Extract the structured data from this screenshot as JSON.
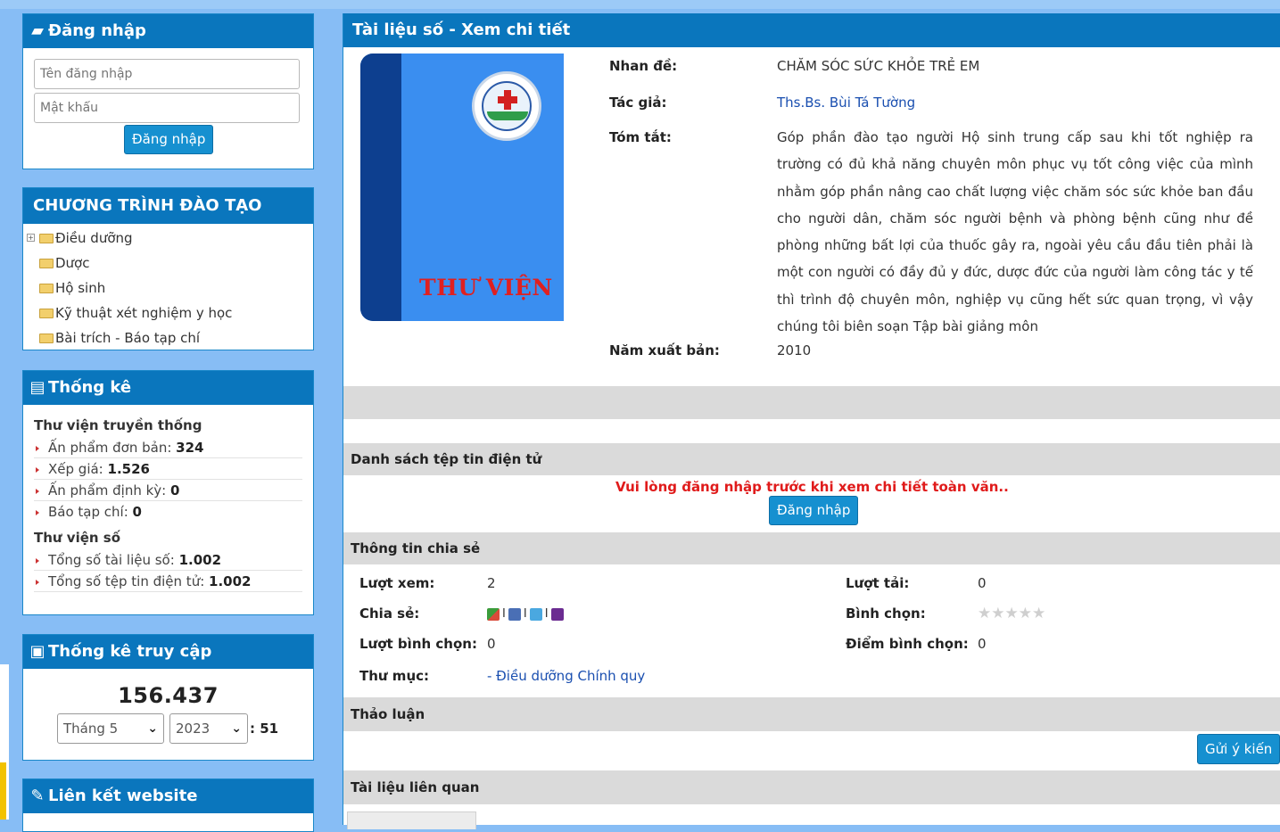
{
  "login": {
    "title": "Đăng nhập",
    "username_placeholder": "Tên đăng nhập",
    "password_placeholder": "Mật khẩu",
    "button": "Đăng nhập"
  },
  "program": {
    "title": "CHƯƠNG TRÌNH ĐÀO TẠO",
    "items": [
      "Điều dưỡng",
      "Dược",
      "Hộ sinh",
      "Kỹ thuật xét nghiệm y học",
      "Bài trích - Báo tạp chí"
    ]
  },
  "stats": {
    "title": "Thống kê",
    "traditional_title": "Thư viện truyền thống",
    "traditional": [
      {
        "label": "Ấn phẩm đơn bản:",
        "value": "324"
      },
      {
        "label": "Xếp giá:",
        "value": "1.526"
      },
      {
        "label": "Ấn phẩm định kỳ:",
        "value": "0"
      },
      {
        "label": "Báo tạp chí:",
        "value": "0"
      }
    ],
    "digital_title": "Thư viện số",
    "digital": [
      {
        "label": "Tổng số tài liệu số:",
        "value": "1.002"
      },
      {
        "label": "Tổng số tệp tin điện tử:",
        "value": "1.002"
      }
    ]
  },
  "access": {
    "title": "Thống kê truy cập",
    "total": "156.437",
    "month": "Tháng 5",
    "year": "2023",
    "month_count": ": 51"
  },
  "links": {
    "title": "Liên kết website"
  },
  "main": {
    "title": "Tài liệu số - Xem chi tiết",
    "cover_text": "THƯ VIỆN",
    "fields": {
      "title_label": "Nhan đề:",
      "title_value": "CHĂM SÓC SỨC KHỎE TRẺ EM",
      "author_label": "Tác giả:",
      "author_value": "Ths.Bs. Bùi Tá Tường",
      "summary_label": "Tóm tắt:",
      "summary_value": "Góp phần đào tạo người Hộ sinh trung cấp sau khi tốt nghiệp ra trường có đủ khả năng chuyên môn phục vụ tốt công việc của mình nhằm góp phần nâng cao chất lượng việc chăm sóc sức khỏe ban đầu cho người dân, chăm sóc người bệnh và phòng bệnh cũng như đề phòng những bất lợi của thuốc gây ra, ngoài yêu cầu đầu tiên phải là một con người có đầy đủ y đức, dược đức của người làm công tác y tế thì trình độ chuyên môn, nghiệp vụ cũng hết sức quan trọng, vì vậy chúng tôi biên soạn Tập bài giảng môn",
      "year_label": "Năm xuất bản:",
      "year_value": "2010"
    },
    "files_title": "Danh sách tệp tin điện tử",
    "files_warning": "Vui lòng đăng nhập trước khi xem chi tiết toàn văn..",
    "files_login": "Đăng nhập",
    "share_title": "Thông tin chia sẻ",
    "share": {
      "views_label": "Lượt xem:",
      "views_value": "2",
      "downloads_label": "Lượt tải:",
      "downloads_value": "0",
      "share_label": "Chia sẻ:",
      "vote_label": "Bình chọn:",
      "vote_count_label": "Lượt bình chọn:",
      "vote_count_value": "0",
      "vote_score_label": "Điểm bình chọn:",
      "vote_score_value": "0",
      "folder_label": "Thư mục:",
      "folder_value": "- Điều dưỡng Chính quy",
      "separator": "I",
      "rating": 0,
      "rating_max": 5
    },
    "discussion_title": "Thảo luận",
    "feedback_button": "Gửi ý kiến",
    "related_title": "Tài liệu liên quan"
  },
  "colors": {
    "header_blue": "#0a76bd",
    "button_blue": "#1690d0",
    "warning_red": "#e01b1b",
    "link_blue": "#1a4fb0"
  }
}
